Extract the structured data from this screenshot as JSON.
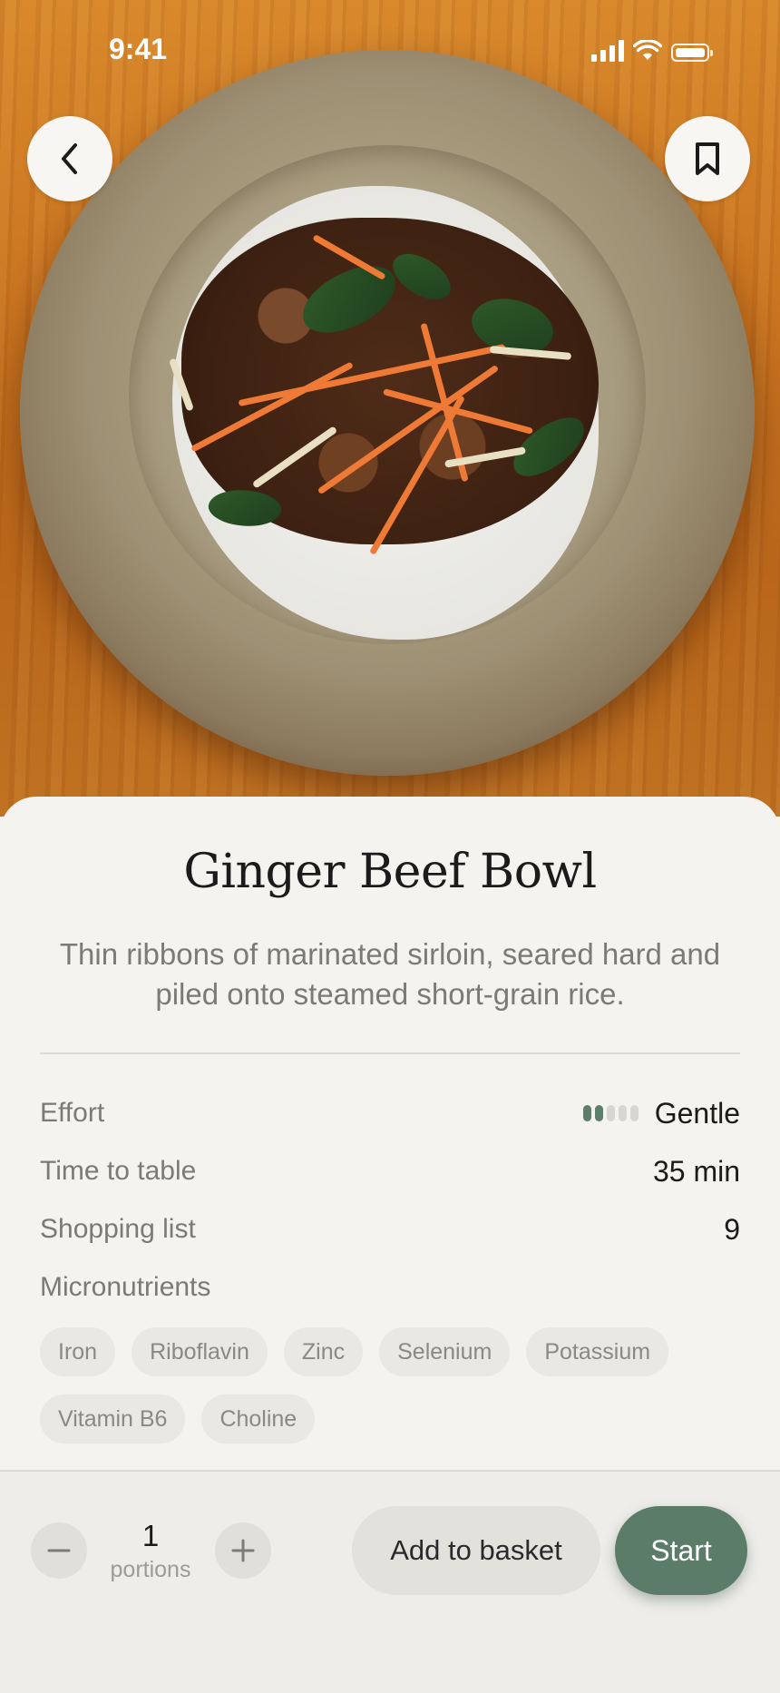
{
  "status_bar": {
    "time": "9:41"
  },
  "hero": {
    "image_alt": "Ginger beef with greens and carrots over rice in a ceramic bowl"
  },
  "nav": {
    "back_icon": "chevron-left-icon",
    "bookmark_icon": "bookmark-icon"
  },
  "recipe": {
    "title": "Ginger Beef Bowl",
    "description": "Thin ribbons of marinated sirloin, seared hard and piled onto steamed short-grain rice."
  },
  "details": {
    "effort_label": "Effort",
    "effort_value": "Gentle",
    "effort_level": 2,
    "effort_max": 5,
    "time_label": "Time to table",
    "time_value": "35 min",
    "shopping_label": "Shopping list",
    "shopping_value": "9",
    "micronutrients_label": "Micronutrients"
  },
  "micronutrients": [
    "Iron",
    "Riboflavin",
    "Zinc",
    "Selenium",
    "Potassium",
    "Vitamin B6",
    "Choline"
  ],
  "portions": {
    "count": "1",
    "unit": "portions"
  },
  "actions": {
    "basket_label": "Add to basket",
    "start_label": "Start"
  },
  "colors": {
    "accent": "#5a7c68",
    "background": "#f4f3ef",
    "chip": "#e9e8e3"
  }
}
